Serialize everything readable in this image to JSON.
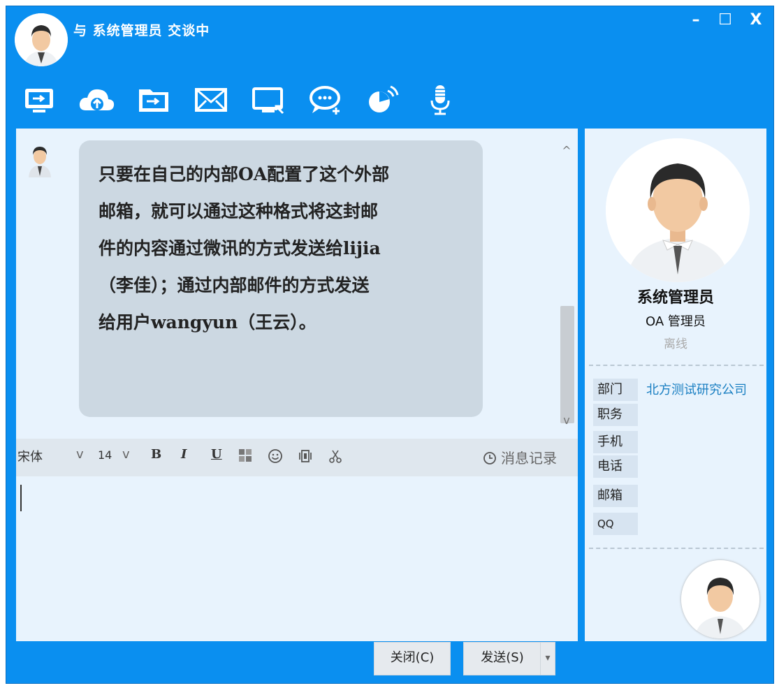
{
  "window": {
    "title": "与 系统管理员 交谈中",
    "minimize": "–",
    "maximize": "☐",
    "close": "X"
  },
  "toolbar": {
    "icons": [
      "remote-desktop-icon",
      "cloud-upload-icon",
      "send-file-icon",
      "mail-icon",
      "screen-share-icon",
      "chat-plus-icon",
      "remote-assist-icon",
      "microphone-icon"
    ]
  },
  "chat": {
    "message": "只要在自己的内部OA配置了这个外部\n邮箱，就可以通过这种格式将这封邮\n件的内容通过微讯的方式发送给lijia\n（李佳）；通过内部邮件的方式发送\n给用户wangyun（王云）。",
    "scroll_up": "^",
    "scroll_down": "v"
  },
  "format_bar": {
    "font": "宋体",
    "font_arrow": "v",
    "size": "14",
    "size_arrow": "v",
    "bold": "B",
    "italic": "I",
    "underline": "U",
    "history": "消息记录"
  },
  "profile": {
    "name": "系统管理员",
    "role": "OA 管理员",
    "status": "离线",
    "labels": [
      "部门",
      "职务",
      "手机",
      "电话",
      "邮箱",
      "QQ"
    ],
    "department": "北方测试研究公司"
  },
  "buttons": {
    "close": "关闭(C)",
    "send": "发送(S)",
    "send_arrow": "▾"
  },
  "colors": {
    "accent": "#0a8ff0",
    "panel": "#e8f3fd",
    "bubble": "#ccd8e2",
    "link": "#1a7fc2"
  }
}
